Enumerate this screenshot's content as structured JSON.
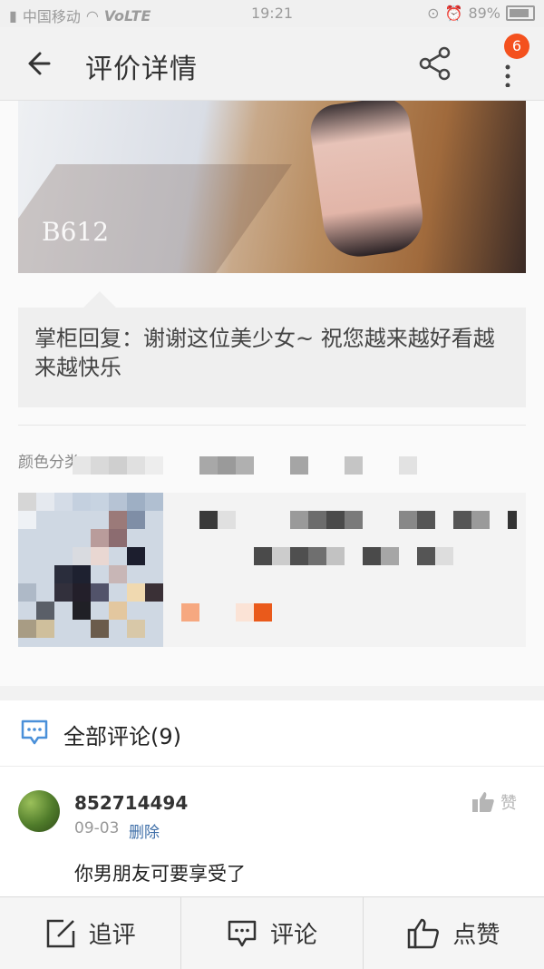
{
  "status_bar": {
    "carrier": "中国移动",
    "network": "VoLTE",
    "time": "19:21",
    "battery": "89%"
  },
  "nav": {
    "title": "评价详情",
    "badge_count": "6"
  },
  "review": {
    "photo_tag": "B612",
    "reply_text": "掌柜回复：谢谢这位美少女~ 祝您越来越好看越来越快乐",
    "sku_label": "颜色分类"
  },
  "comments": {
    "header": "全部评论(9)",
    "items": [
      {
        "username": "852714494",
        "date": "09-03",
        "delete_label": "删除",
        "like_label": "赞",
        "text": "你男朋友可要享受了"
      }
    ]
  },
  "bottom_bar": {
    "follow_up_label": "追评",
    "comment_label": "评论",
    "like_label": "点赞"
  },
  "colors": {
    "accent": "#f4511e",
    "link": "#3f6fa8",
    "icon": "#4a90d9"
  }
}
